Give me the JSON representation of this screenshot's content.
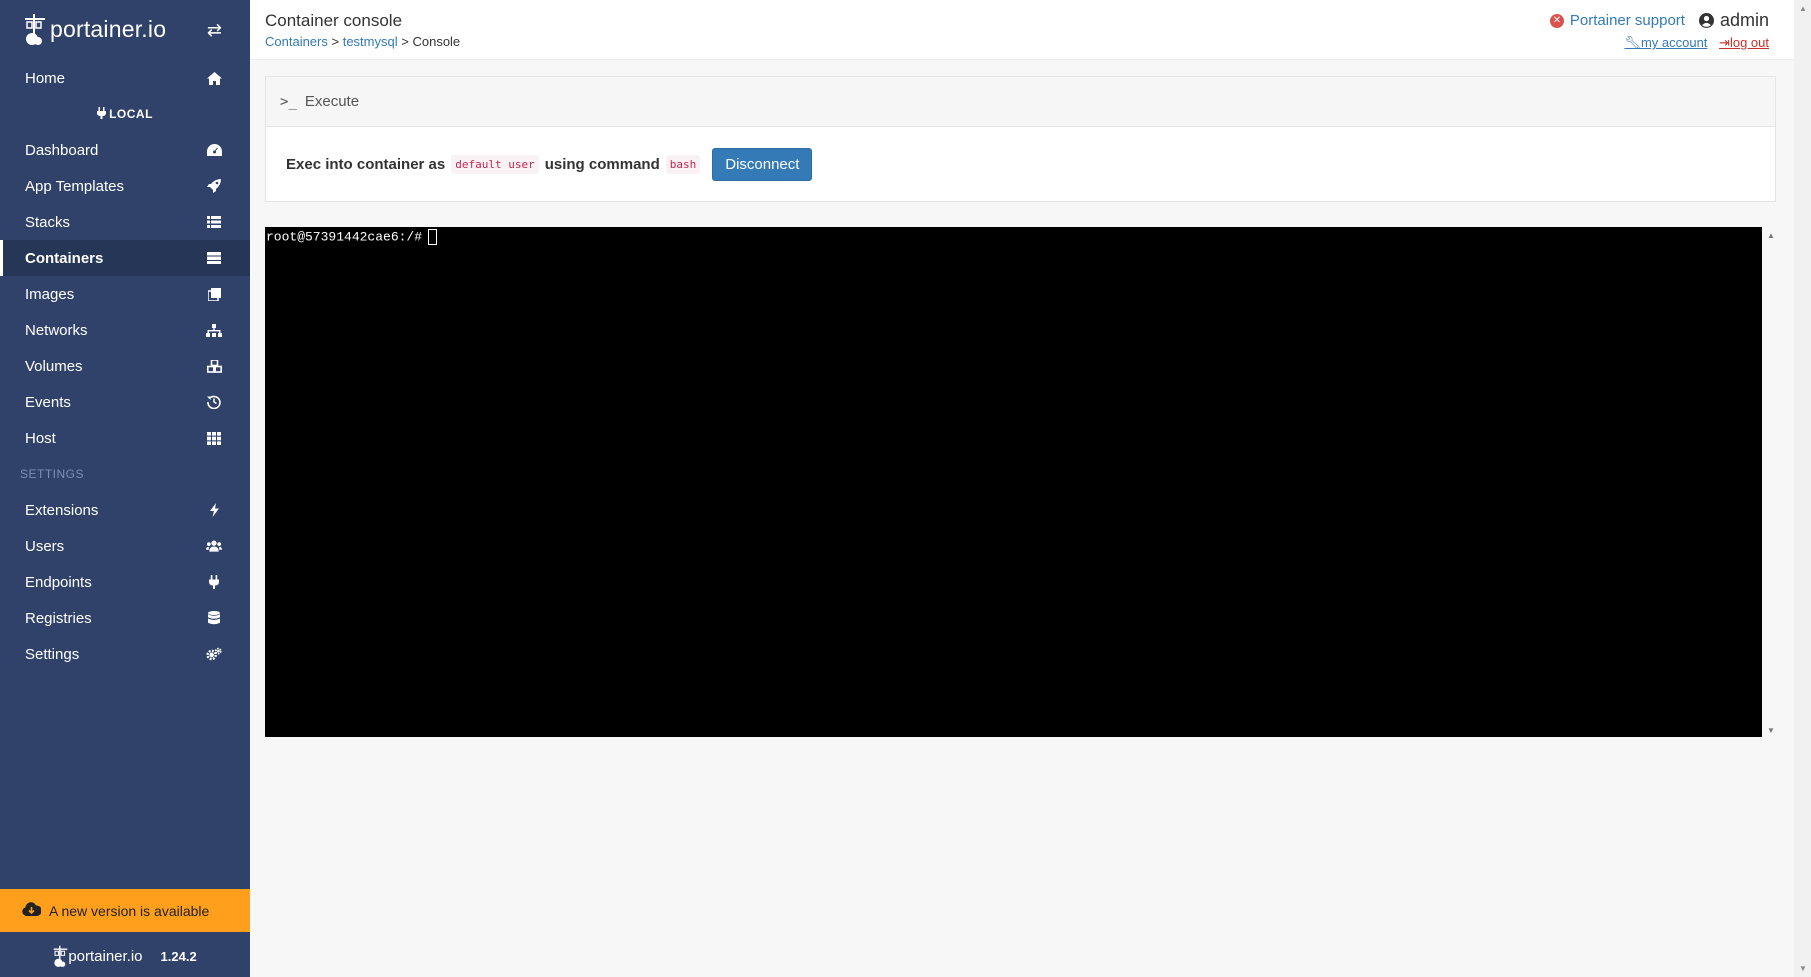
{
  "brand": {
    "name": "portainer.io"
  },
  "sidebar": {
    "home": "Home",
    "endpoint": "LOCAL",
    "items": [
      {
        "label": "Dashboard",
        "icon": "tachometer-icon"
      },
      {
        "label": "App Templates",
        "icon": "rocket-icon"
      },
      {
        "label": "Stacks",
        "icon": "th-list-icon"
      },
      {
        "label": "Containers",
        "icon": "server-icon"
      },
      {
        "label": "Images",
        "icon": "clone-icon"
      },
      {
        "label": "Networks",
        "icon": "sitemap-icon"
      },
      {
        "label": "Volumes",
        "icon": "cubes-icon"
      },
      {
        "label": "Events",
        "icon": "history-icon"
      },
      {
        "label": "Host",
        "icon": "th-icon"
      }
    ],
    "settings_title": "SETTINGS",
    "settings_items": [
      {
        "label": "Extensions",
        "icon": "bolt-icon"
      },
      {
        "label": "Users",
        "icon": "users-icon"
      },
      {
        "label": "Endpoints",
        "icon": "plug-icon"
      },
      {
        "label": "Registries",
        "icon": "database-icon"
      },
      {
        "label": "Settings",
        "icon": "cogs-icon"
      }
    ],
    "update_banner": "A new version is available",
    "footer_brand": "portainer.io",
    "version": "1.24.2"
  },
  "header": {
    "title": "Container console",
    "breadcrumb": {
      "c1": "Containers",
      "c2": "testmysql",
      "current": "Console",
      "sep": ">"
    },
    "support": "Portainer support",
    "user": "admin",
    "my_account": "my account",
    "logout": "log out"
  },
  "execute": {
    "title": "Execute",
    "text1": "Exec into container as",
    "user_code": "default user",
    "text2": "using command",
    "command_code": "bash",
    "button": "Disconnect"
  },
  "terminal": {
    "prompt": "root@57391442cae6:/#"
  },
  "colors": {
    "sidebar": "#30426a",
    "accent": "#337ab7",
    "banner": "#ff9f1c"
  }
}
